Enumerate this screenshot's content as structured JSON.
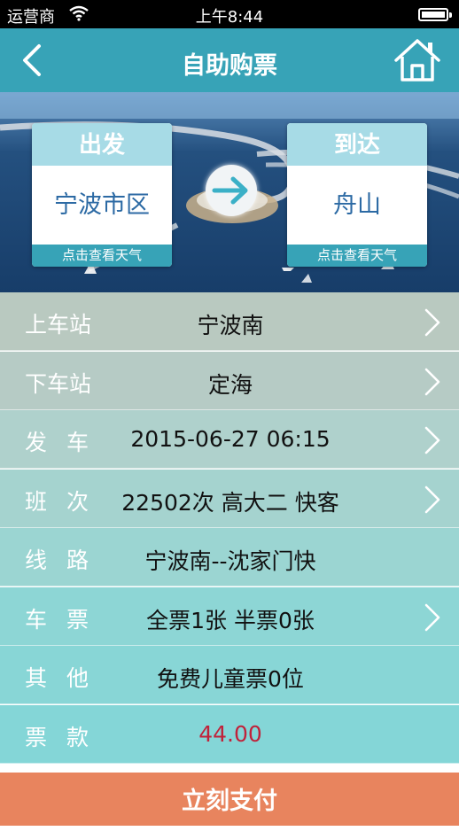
{
  "status_bar": {
    "carrier": "运营商",
    "time": "上午8:44"
  },
  "nav": {
    "title": "自助购票"
  },
  "route": {
    "departure": {
      "header": "出发",
      "city": "宁波市区",
      "weather_link": "点击查看天气"
    },
    "arrival": {
      "header": "到达",
      "city": "舟山",
      "weather_link": "点击查看天气"
    }
  },
  "details": [
    {
      "label": "上车站",
      "value": "宁波南",
      "has_arrow": true,
      "bg": "#b9c9c0"
    },
    {
      "label": "下车站",
      "value": "定海",
      "has_arrow": true,
      "bg": "#b6cbc5"
    },
    {
      "label": "发车",
      "value": "2015-06-27 06:15",
      "has_arrow": true,
      "bg": "#afd1cc"
    },
    {
      "label": "班次",
      "value": "22502次 高大二 快客",
      "has_arrow": true,
      "bg": "#a5d3cf"
    },
    {
      "label": "线路",
      "value": "宁波南--沈家门快",
      "has_arrow": false,
      "bg": "#9bd5d2"
    },
    {
      "label": "车票",
      "value": "全票1张 半票0张",
      "has_arrow": true,
      "bg": "#8dd6d5"
    },
    {
      "label": "其他",
      "value": "免费儿童票0位",
      "has_arrow": false,
      "bg": "#88d6d6"
    },
    {
      "label": "票款",
      "value": "44.00",
      "has_arrow": false,
      "bg": "#84d6d7"
    }
  ],
  "pay_button": "立刻支付",
  "colors": {
    "nav": "#37a3b7",
    "pay": "#e8845e",
    "price": "#c0223a"
  }
}
